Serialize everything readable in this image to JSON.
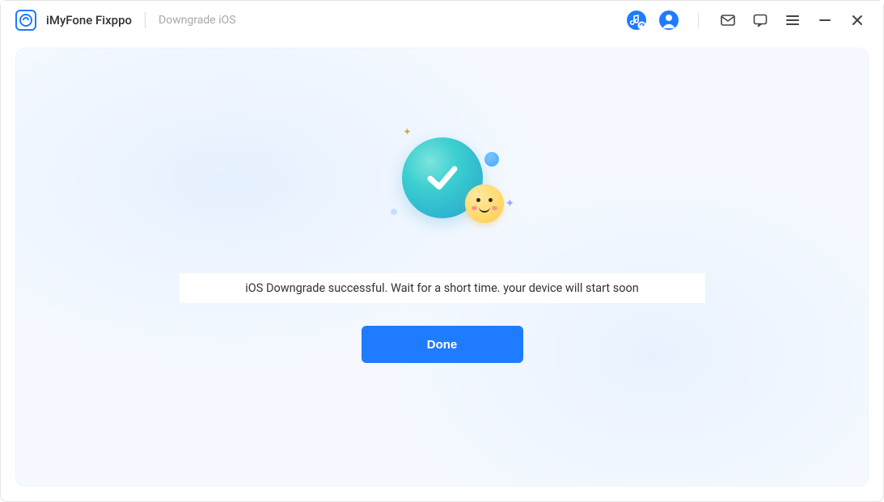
{
  "titlebar": {
    "app_name": "iMyFone Fixppo",
    "breadcrumb": "Downgrade iOS",
    "icons": {
      "music": "music-update-icon",
      "account": "account-icon",
      "mail": "mail-icon",
      "feedback": "feedback-icon",
      "menu": "menu-icon",
      "minimize": "minimize-icon",
      "close": "close-icon"
    }
  },
  "main": {
    "status_message": "iOS Downgrade successful. Wait for a short time. your device will start soon",
    "done_label": "Done"
  },
  "colors": {
    "accent": "#1f7bff",
    "content_bg": "#f5f9ff"
  }
}
